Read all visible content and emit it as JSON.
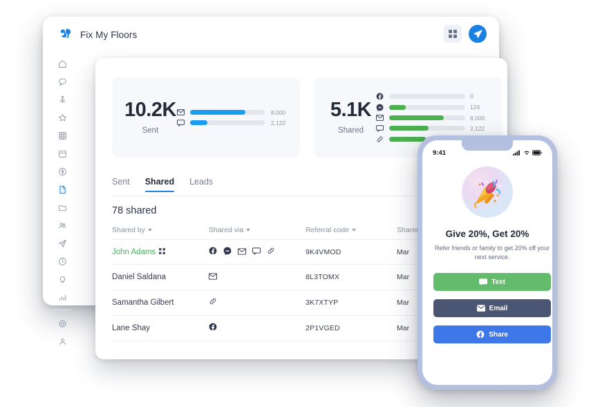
{
  "app": {
    "logo_icon": "brand-logo-icon",
    "title": "Fix My Floors",
    "grid_icon": "qr-grid-icon",
    "send_icon": "paper-plane-icon"
  },
  "sidebar": {
    "items": [
      {
        "icon": "home-icon",
        "name": "home"
      },
      {
        "icon": "chat-icon",
        "name": "messages"
      },
      {
        "icon": "tools-icon",
        "name": "jobs"
      },
      {
        "icon": "star-icon",
        "name": "reviews"
      },
      {
        "icon": "grid-icon",
        "name": "apps"
      },
      {
        "icon": "calendar-icon",
        "name": "schedule"
      },
      {
        "icon": "dollar-icon",
        "name": "payments"
      },
      {
        "icon": "document-icon",
        "name": "referrals",
        "active": true
      },
      {
        "icon": "folder-icon",
        "name": "files"
      },
      {
        "icon": "people-icon",
        "name": "customers"
      },
      {
        "icon": "send-icon",
        "name": "campaigns"
      },
      {
        "icon": "clock-icon",
        "name": "history"
      },
      {
        "icon": "bulb-icon",
        "name": "insights"
      },
      {
        "icon": "bars-icon",
        "name": "reports"
      }
    ],
    "footer_items": [
      {
        "icon": "gear-icon",
        "name": "settings"
      },
      {
        "icon": "person-icon",
        "name": "account"
      }
    ]
  },
  "stats": {
    "sent": {
      "value": "10.2K",
      "label": "Sent",
      "accent": "#1a9cf0",
      "bars": [
        {
          "icon": "envelope-icon",
          "name": "email",
          "value": "8,000",
          "pct": 74
        },
        {
          "icon": "sms-icon",
          "name": "sms",
          "value": "2,122",
          "pct": 23
        }
      ]
    },
    "shared": {
      "value": "5.1K",
      "label": "Shared",
      "accent": "#4caf50",
      "bars": [
        {
          "icon": "facebook-icon",
          "name": "facebook",
          "value": "0",
          "pct": 0
        },
        {
          "icon": "messenger-icon",
          "name": "messenger",
          "value": "124",
          "pct": 22
        },
        {
          "icon": "envelope-icon",
          "name": "email",
          "value": "8,000",
          "pct": 72
        },
        {
          "icon": "sms-icon",
          "name": "sms",
          "value": "2,122",
          "pct": 52
        },
        {
          "icon": "link-icon",
          "name": "link",
          "value": "",
          "pct": 48
        }
      ]
    }
  },
  "tabs": [
    {
      "label": "Sent",
      "active": false
    },
    {
      "label": "Shared",
      "active": true
    },
    {
      "label": "Leads",
      "active": false
    }
  ],
  "table": {
    "count_text": "78 shared",
    "headers": [
      "Shared by",
      "Shared via",
      "Referral code",
      "Shared on"
    ],
    "rows": [
      {
        "name": "John Adams",
        "highlight": true,
        "badge_icon": "qr-badge-icon",
        "via": [
          "facebook-icon",
          "messenger-icon",
          "envelope-icon",
          "sms-icon",
          "link-icon"
        ],
        "code": "9K4VMOD",
        "date": "Mar"
      },
      {
        "name": "Daniel Saldana",
        "highlight": false,
        "badge_icon": "",
        "via": [
          "envelope-icon"
        ],
        "code": "8L3TOMX",
        "date": "Mar"
      },
      {
        "name": "Samantha Gilbert",
        "highlight": false,
        "badge_icon": "",
        "via": [
          "link-icon"
        ],
        "code": "3K7XTYP",
        "date": "Mar"
      },
      {
        "name": "Lane Shay",
        "highlight": false,
        "badge_icon": "",
        "via": [
          "facebook-icon"
        ],
        "code": "2P1VGED",
        "date": "Mar"
      }
    ]
  },
  "phone": {
    "status_time": "9:41",
    "status_icons": [
      "cellular-icon",
      "wifi-icon",
      "battery-icon"
    ],
    "hero_icon": "party-popper-icon",
    "headline": "Give 20%, Get 20%",
    "subtext": "Refer friends or family to get 20% off your next service.",
    "buttons": [
      {
        "label": "Text",
        "icon": "sms-icon",
        "color": "#64bb6c"
      },
      {
        "label": "Email",
        "icon": "envelope-icon",
        "color": "#4b5672"
      },
      {
        "label": "Share",
        "icon": "facebook-icon",
        "color": "#3e78e8"
      }
    ]
  }
}
